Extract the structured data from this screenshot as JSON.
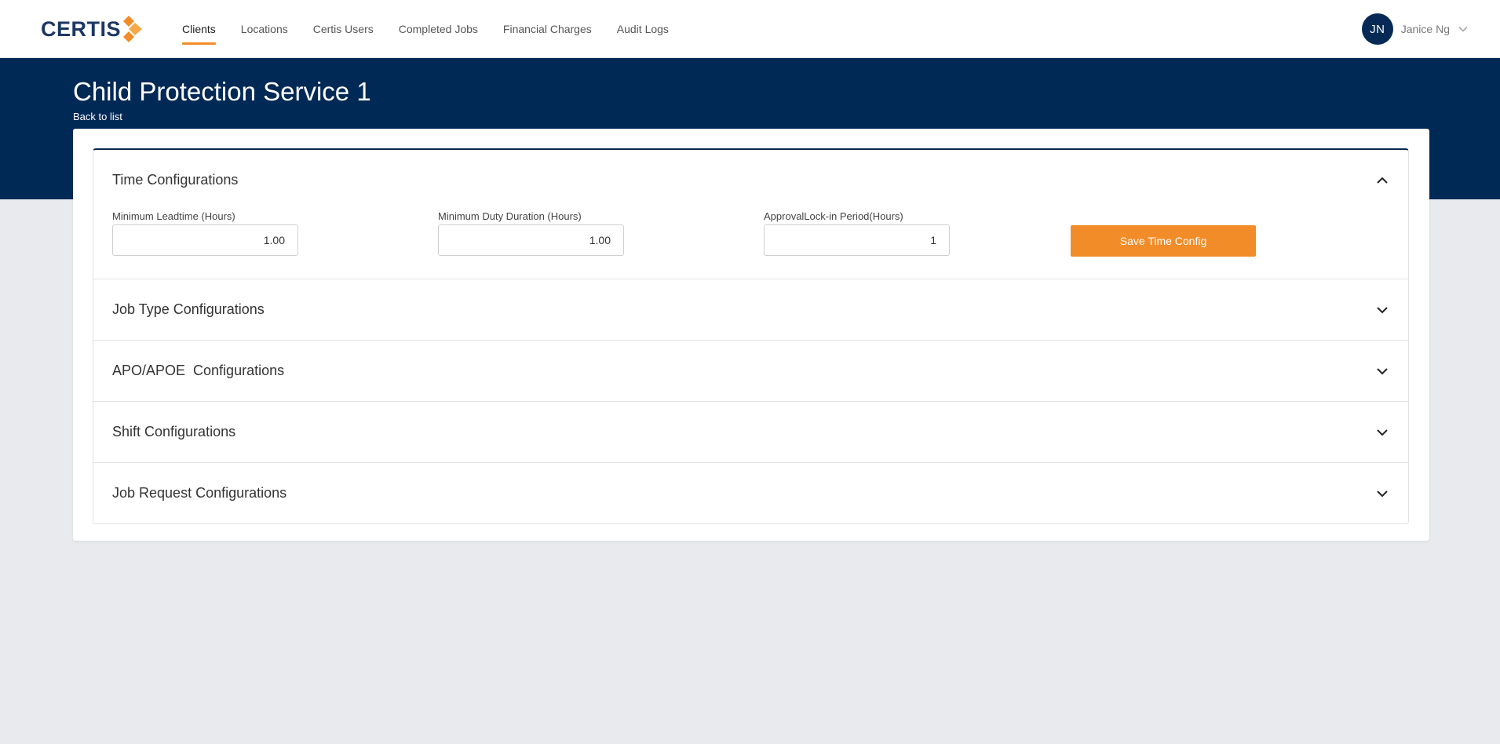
{
  "brand": {
    "name": "CERTIS",
    "accent": "#f28c28",
    "navy": "#012956"
  },
  "nav": {
    "items": [
      {
        "label": "Clients",
        "active": true
      },
      {
        "label": "Locations",
        "active": false
      },
      {
        "label": "Certis Users",
        "active": false
      },
      {
        "label": "Completed Jobs",
        "active": false
      },
      {
        "label": "Financial Charges",
        "active": false
      },
      {
        "label": "Audit Logs",
        "active": false
      }
    ]
  },
  "user": {
    "initials": "JN",
    "name": "Janice Ng",
    "icon": "chevron-down-icon"
  },
  "header": {
    "title": "Child Protection Service 1",
    "back_link": "Back to list"
  },
  "sections": {
    "time": {
      "title": "Time Configurations",
      "expanded": true,
      "min_leadtime": {
        "label": "Minimum Leadtime (Hours)",
        "value": "1.00"
      },
      "min_duty": {
        "label": "Minimum Duty Duration (Hours)",
        "value": "1.00"
      },
      "approval_lock": {
        "label": "ApprovalLock-in Period(Hours)",
        "value": "1"
      },
      "save_label": "Save Time Config"
    },
    "job_type": {
      "title": "Job Type Configurations",
      "expanded": false
    },
    "apo": {
      "title": "APO/APOE  Configurations",
      "expanded": false
    },
    "shift": {
      "title": "Shift Configurations",
      "expanded": false
    },
    "job_request": {
      "title": "Job Request Configurations",
      "expanded": false
    }
  }
}
